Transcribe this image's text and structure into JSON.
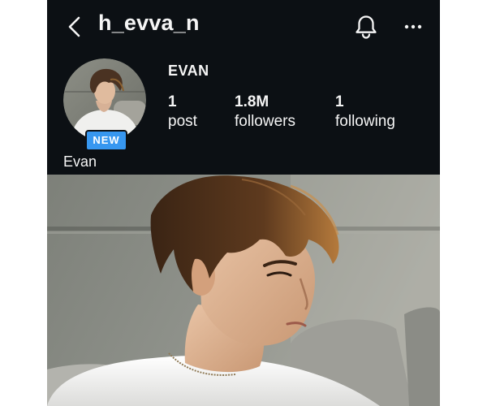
{
  "header": {
    "username": "h_evva_n",
    "icons": {
      "back": "chevron-left-icon",
      "notifications": "bell-icon",
      "more": "more-horizontal-icon"
    }
  },
  "profile": {
    "avatar_badge": "NEW",
    "display_name": "EVAN",
    "bio_name": "Evan",
    "stats": [
      {
        "value": "1",
        "label": "post"
      },
      {
        "value": "1.8M",
        "label": "followers"
      },
      {
        "value": "1",
        "label": "following"
      }
    ]
  },
  "colors": {
    "background": "#0c1014",
    "text": "#f5f5f5",
    "badge": "#3797f0"
  }
}
